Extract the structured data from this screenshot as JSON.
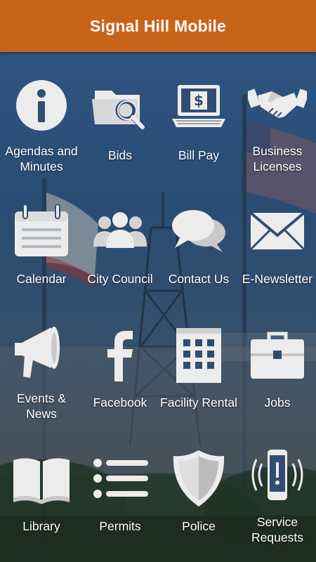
{
  "app": {
    "title": "Signal Hill Mobile"
  },
  "colors": {
    "header": "#c8631a",
    "icon": "#ececec",
    "label": "#ffffff"
  },
  "tiles": [
    {
      "label": "Agendas and Minutes",
      "icon": "info-icon"
    },
    {
      "label": "Bids",
      "icon": "folder-search-icon"
    },
    {
      "label": "Bill Pay",
      "icon": "laptop-dollar-icon"
    },
    {
      "label": "Business Licenses",
      "icon": "handshake-icon"
    },
    {
      "label": "Calendar",
      "icon": "calendar-icon"
    },
    {
      "label": "City Council",
      "icon": "people-icon"
    },
    {
      "label": "Contact Us",
      "icon": "chat-bubbles-icon"
    },
    {
      "label": "E-Newsletter",
      "icon": "envelope-icon"
    },
    {
      "label": "Events & News",
      "icon": "megaphone-icon"
    },
    {
      "label": "Facebook",
      "icon": "facebook-icon"
    },
    {
      "label": "Facility Rental",
      "icon": "building-icon"
    },
    {
      "label": "Jobs",
      "icon": "briefcase-icon"
    },
    {
      "label": "Library",
      "icon": "book-icon"
    },
    {
      "label": "Permits",
      "icon": "list-icon"
    },
    {
      "label": "Police",
      "icon": "shield-icon"
    },
    {
      "label": "Service Requests",
      "icon": "phone-alert-icon"
    }
  ]
}
